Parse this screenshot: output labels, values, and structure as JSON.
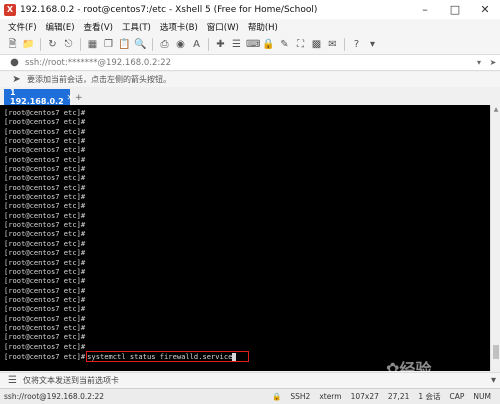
{
  "window": {
    "title": "192.168.0.2 - root@centos7:/etc - Xshell 5 (Free for Home/School)"
  },
  "menu": [
    "文件(F)",
    "编辑(E)",
    "查看(V)",
    "工具(T)",
    "选项卡(B)",
    "窗口(W)",
    "帮助(H)"
  ],
  "address": {
    "text": "ssh://root:*******@192.168.0.2:22"
  },
  "hint": {
    "text": "要添加当前会话，点击左侧的箭头按钮。"
  },
  "tab": {
    "label": "1 192.168.0.2"
  },
  "terminal": {
    "prompt": "[root@centos7 etc]#",
    "command": "systemctl status firewalld.service"
  },
  "sendbar": {
    "text": "仅将文本发送到当前选项卡"
  },
  "status": {
    "session": "ssh://root@192.168.0.2:22",
    "protocol": "SSH2",
    "term": "xterm",
    "size": "107x27",
    "cursor": "27,21",
    "sessions": "1 会话",
    "cap": "CAP",
    "num": "NUM"
  },
  "watermark": {
    "text": "经验"
  }
}
